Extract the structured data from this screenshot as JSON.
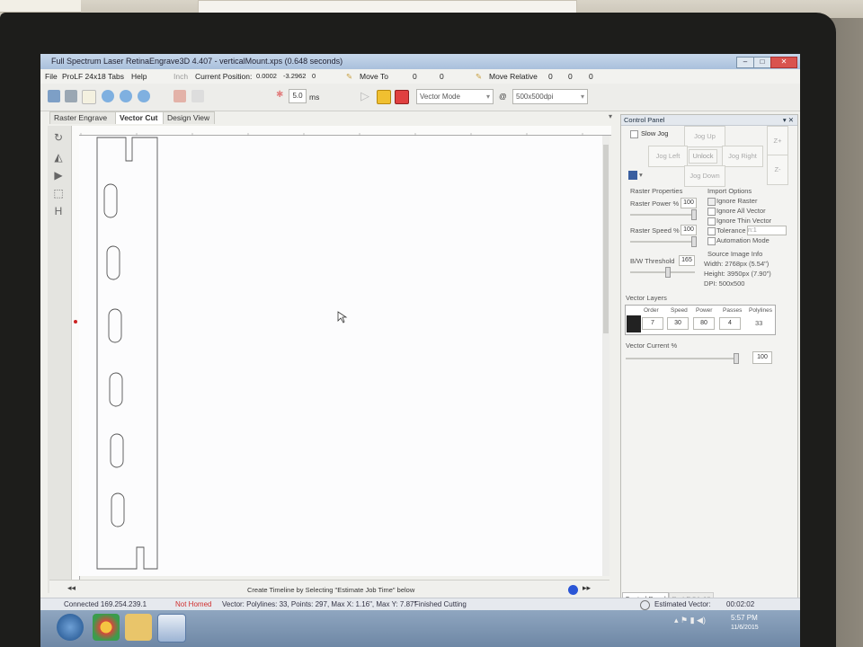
{
  "window": {
    "title": "Full Spectrum Laser RetinaEngrave3D 4.407 - verticalMount.xps (0.648 seconds)"
  },
  "menu": {
    "items": [
      "File",
      "ProLF 24x18",
      "Tabs",
      "Help"
    ]
  },
  "toolbar": {
    "unit": "Inch",
    "current_position_label": "Current Position:",
    "pos_x": "0.0002",
    "pos_y": "-3.2962",
    "pos_z": "0",
    "ms_value": "5.0",
    "ms_label": "ms",
    "move_to_label": "Move To",
    "move_to_x": "0",
    "move_to_y": "0",
    "move_relative_label": "Move Relative",
    "move_rel_x": "0",
    "move_rel_y": "0",
    "move_rel_z": "0",
    "mode_value": "Vector Mode",
    "at_symbol": "@",
    "dpi_value": "500x500dpi"
  },
  "tabs": [
    "Raster Engrave",
    "Vector Cut",
    "Design View"
  ],
  "active_tab": "Vector Cut",
  "canvas": {
    "hint": "Create Timeline by Selecting \"Estimate Job Time\" below"
  },
  "control_panel": {
    "title": "Control Panel",
    "slow_jog": "Slow Jog",
    "jog_up": "Jog Up",
    "jog_left": "Jog Left",
    "unlock": "Unlock",
    "jog_right": "Jog Right",
    "jog_down": "Jog Down",
    "z_plus": "Z+",
    "z_minus": "Z-",
    "raster_properties": "Raster Properties",
    "raster_power_label": "Raster Power %",
    "raster_power": "100",
    "raster_speed_label": "Raster Speed %",
    "raster_speed": "100",
    "bw_threshold_label": "B/W Threshold",
    "bw_threshold": "165",
    "import_options": "Import Options",
    "ignore_raster": "Ignore Raster",
    "ignore_all_vector": "Ignore All Vector",
    "ignore_thin_vector": "Ignore Thin Vector",
    "tolerance": "Tolerance",
    "tolerance_value": "n:1",
    "automation_mode": "Automation Mode",
    "source_image_info": "Source Image Info",
    "width": "Width:  2768px (5.54\")",
    "height": "Height: 3950px (7.90\")",
    "dpi": "DPI: 500x500",
    "vector_layers": "Vector Layers",
    "layer_headers": [
      "Order",
      "Speed",
      "Power",
      "Passes",
      "Polylines"
    ],
    "layer_row": {
      "order": "7",
      "speed": "30",
      "power": "80",
      "passes": "4",
      "polylines": "33"
    },
    "vector_current_label": "Vector Current %",
    "vector_current": "100",
    "bottom_tabs": [
      "Control Panel",
      "ProLF 24x18"
    ]
  },
  "status": {
    "connected": "Connected 169.254.239.1",
    "homed": "Not Homed",
    "vector_info": "Vector: Polylines: 33, Points: 297, Max X: 1.16\", Max Y: 7.87\"",
    "job_state": "Finished Cutting",
    "estimated_label": "Estimated Vector:",
    "estimated_time": "00:02:02"
  },
  "taskbar": {
    "time": "5:57 PM",
    "date": "11/6/2015"
  },
  "colors": {
    "accent_red": "#cc2222",
    "title_blue": "#a9c0dc",
    "status_red": "#d03030"
  }
}
